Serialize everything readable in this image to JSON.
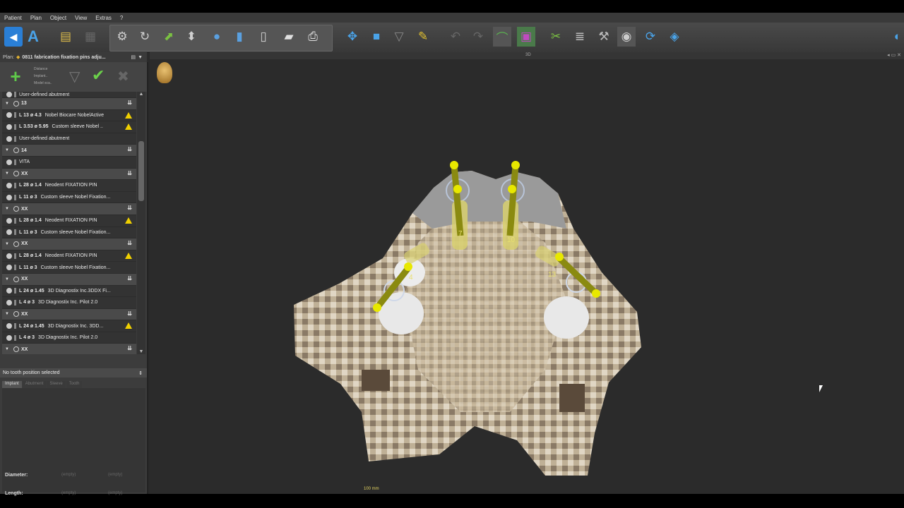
{
  "menu": [
    "Patient",
    "Plan",
    "Object",
    "View",
    "Extras",
    "?"
  ],
  "plan": {
    "label": "Plan:",
    "name": "0811 fabrication fixation pins adju..."
  },
  "plan_controls": {
    "lines": [
      "Distance",
      "Implant..",
      "Model sca.."
    ]
  },
  "view": {
    "title": "3D",
    "scale_label": "100 mm"
  },
  "tree": [
    {
      "type": "item",
      "text": "User-defined abutment",
      "partial": true
    },
    {
      "type": "group",
      "text": "13"
    },
    {
      "type": "item",
      "bold": "L 13  ø 4.3",
      "text": "Nobel Biocare NobelActive",
      "warn": true
    },
    {
      "type": "item",
      "bold": "L 3.53  ø 5.95",
      "text": "Custom sleeve Nobel ..",
      "warn": true
    },
    {
      "type": "item",
      "text": "User-defined abutment",
      "warn": false
    },
    {
      "type": "group",
      "text": "14"
    },
    {
      "type": "item",
      "text": "VITA",
      "warn": false
    },
    {
      "type": "group",
      "text": "XX"
    },
    {
      "type": "item",
      "bold": "L 28  ø 1.4",
      "text": "Neodent FIXATION PIN",
      "warn": false
    },
    {
      "type": "item",
      "bold": "L 11  ø 3",
      "text": "Custom sleeve Nobel Fixation...",
      "warn": false
    },
    {
      "type": "group",
      "text": "XX"
    },
    {
      "type": "item",
      "bold": "L 28  ø 1.4",
      "text": "Neodent FIXATION PIN",
      "warn": true
    },
    {
      "type": "item",
      "bold": "L 11  ø 3",
      "text": "Custom sleeve Nobel Fixation...",
      "warn": false
    },
    {
      "type": "group",
      "text": "XX"
    },
    {
      "type": "item",
      "bold": "L 28  ø 1.4",
      "text": "Neodent FIXATION PIN",
      "warn": true
    },
    {
      "type": "item",
      "bold": "L 11  ø 3",
      "text": "Custom sleeve Nobel Fixation...",
      "warn": false
    },
    {
      "type": "group",
      "text": "XX"
    },
    {
      "type": "item",
      "bold": "L 24  ø 1.45",
      "text": "3D Diagnostix Inc.3DDX Fi...",
      "warn": false
    },
    {
      "type": "item",
      "bold": "L 4  ø 3",
      "text": "3D Diagnostix Inc. Pilot 2.0",
      "warn": false
    },
    {
      "type": "group",
      "text": "XX"
    },
    {
      "type": "item",
      "bold": "L 24  ø 1.45",
      "text": "3D Diagnostix Inc. 3DD...",
      "warn": true
    },
    {
      "type": "item",
      "bold": "L 4  ø 3",
      "text": "3D Diagnostix Inc. Pilot 2.0",
      "warn": false
    },
    {
      "type": "group",
      "text": "XX"
    }
  ],
  "status": "No tooth position selected",
  "tabs": [
    "Implant",
    "Abutment",
    "Sleeve",
    "Tooth"
  ],
  "props": {
    "diameter": "Diameter:",
    "length": "Length:",
    "empty": "(empty)"
  },
  "pins": [
    "7",
    "10",
    "4",
    "13"
  ],
  "colors": {
    "pin": "#d8d400",
    "bone": "#b8a990",
    "background": "#2b2b2b"
  }
}
